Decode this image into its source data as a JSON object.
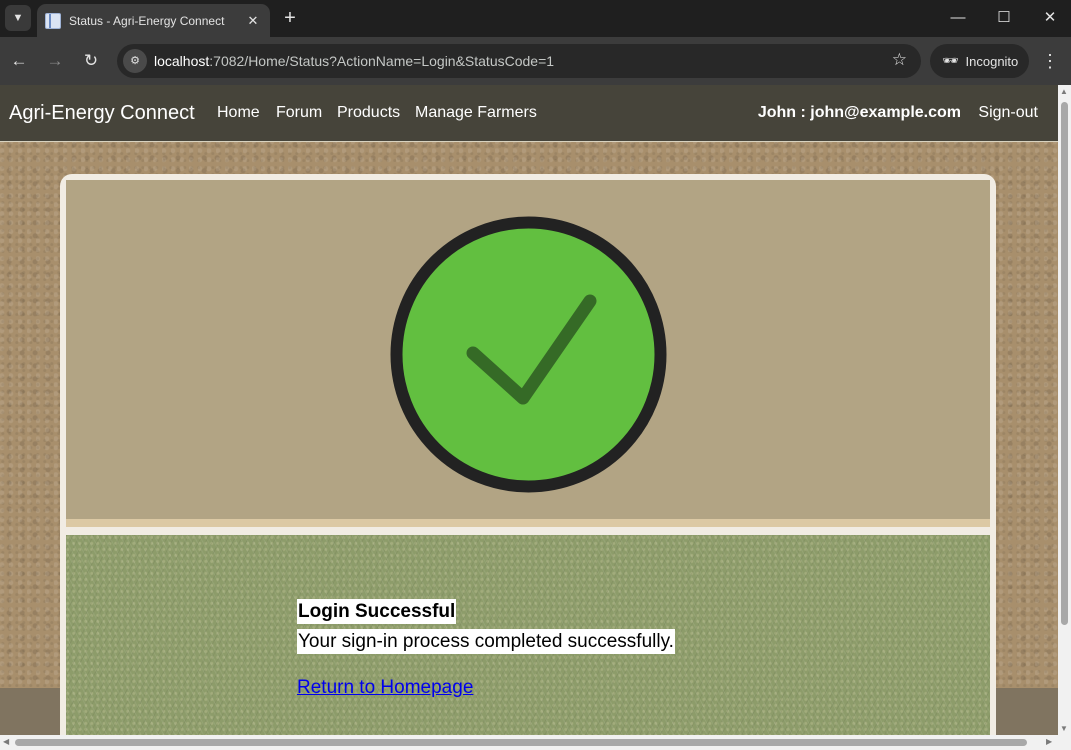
{
  "browser": {
    "tab_title": "Status - Agri-Energy Connect",
    "tab_close_icon": "close-icon",
    "new_tab_symbol": "+",
    "url_host": "localhost",
    "url_rest": ":7082/Home/Status?ActionName=Login&StatusCode=1",
    "profile_label": "Incognito",
    "window_controls": {
      "minimize": "—",
      "maximize": "☐",
      "close": "✕"
    }
  },
  "navbar": {
    "brand": "Agri-Energy Connect",
    "links": [
      "Home",
      "Forum",
      "Products",
      "Manage Farmers"
    ],
    "user": "John : john@example.com",
    "signout": "Sign-out"
  },
  "status": {
    "icon": "check-circle-icon",
    "title": "Login Successful",
    "message": "Your sign-in process completed successfully.",
    "return_link": "Return to Homepage"
  },
  "colors": {
    "check_fill": "#62bf40",
    "check_ring": "#222222",
    "check_mark": "#356a26",
    "navbar_bg": "#46443a",
    "link": "#0000ee"
  }
}
